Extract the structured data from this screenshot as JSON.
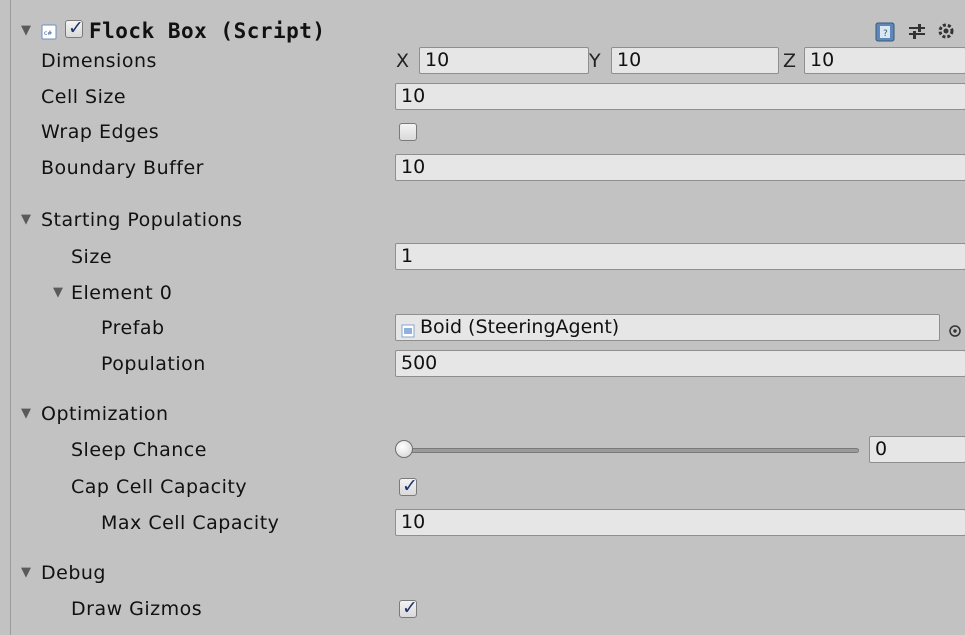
{
  "header": {
    "title": "Flock Box (Script)",
    "enabled": true,
    "icons": [
      "foldout-arrow-icon",
      "csharp-script-icon",
      "help-book-icon",
      "preset-sliders-icon",
      "gear-icon"
    ]
  },
  "fields": {
    "dimensions": {
      "label": "Dimensions",
      "x_label": "X",
      "x": "10",
      "y_label": "Y",
      "y": "10",
      "z_label": "Z",
      "z": "10"
    },
    "cell_size": {
      "label": "Cell Size",
      "value": "10"
    },
    "wrap_edges": {
      "label": "Wrap Edges",
      "checked": false
    },
    "boundary_buffer": {
      "label": "Boundary Buffer",
      "value": "10"
    }
  },
  "starting_populations": {
    "label": "Starting Populations",
    "size_label": "Size",
    "size": "1",
    "element": {
      "label": "Element 0",
      "prefab_label": "Prefab",
      "prefab_value": "Boid (SteeringAgent)",
      "population_label": "Population",
      "population": "500"
    }
  },
  "optimization": {
    "label": "Optimization",
    "sleep_chance_label": "Sleep Chance",
    "sleep_chance": "0",
    "cap_cell_capacity_label": "Cap Cell Capacity",
    "cap_cell_capacity": true,
    "max_cell_capacity_label": "Max Cell Capacity",
    "max_cell_capacity": "10"
  },
  "debug": {
    "label": "Debug",
    "draw_gizmos_label": "Draw Gizmos",
    "draw_gizmos": true
  },
  "colors": {
    "background": "#c2c2c2",
    "field": "#e6e6e6",
    "check": "#20336b"
  }
}
